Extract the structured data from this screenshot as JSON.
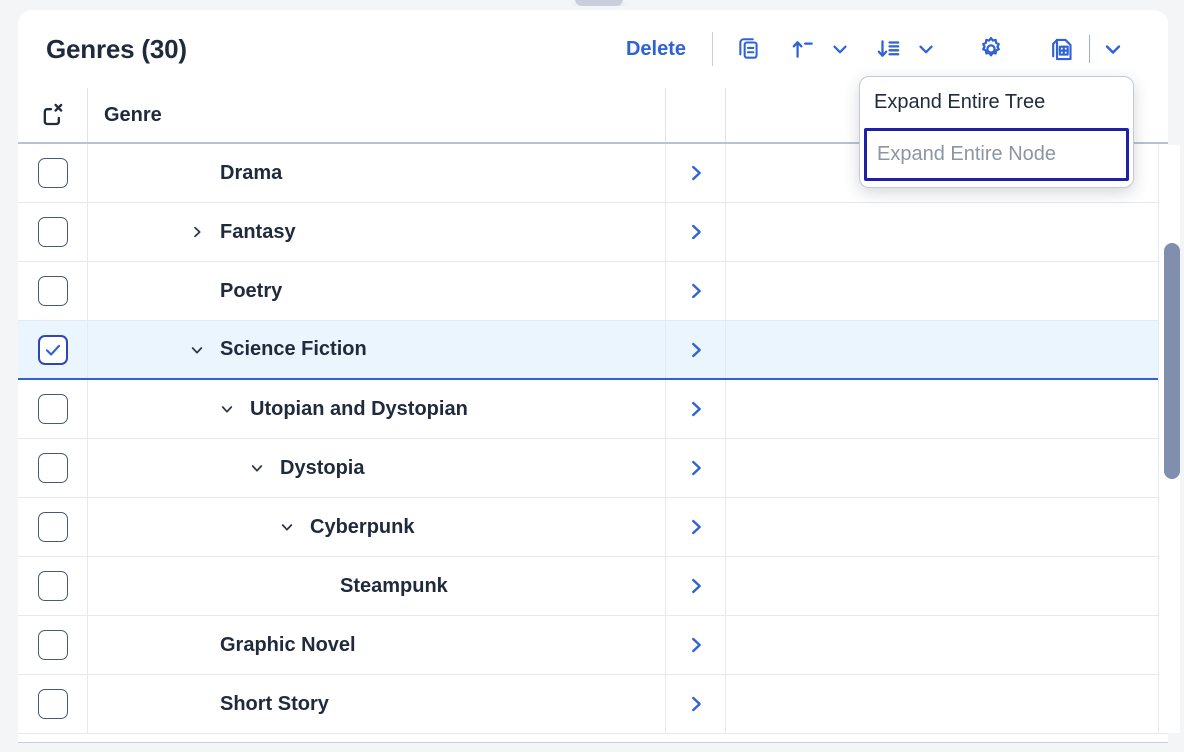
{
  "header": {
    "title": "Genres (30)",
    "delete_label": "Delete",
    "icons": {
      "copy": "copy-rows-icon",
      "insert_above": "insert-above-icon",
      "sort": "sort-descending-icon",
      "settings": "gear-icon",
      "export": "export-table-icon",
      "more": "chevron-down-icon"
    }
  },
  "dropdown": {
    "items": [
      {
        "label": "Expand Entire Tree",
        "disabled": false,
        "focused": false
      },
      {
        "label": "Expand Entire Node",
        "disabled": true,
        "focused": true
      }
    ]
  },
  "table": {
    "select_all_icon": "deselect-all-icon",
    "columns": [
      {
        "label": "Genre"
      }
    ],
    "row_arrow_icon": "chevron-right-icon",
    "rows": [
      {
        "name": "Drama",
        "indent": 0,
        "twisty": "none",
        "checked": false,
        "selected": false
      },
      {
        "name": "Fantasy",
        "indent": 0,
        "twisty": "collapsed",
        "checked": false,
        "selected": false
      },
      {
        "name": "Poetry",
        "indent": 0,
        "twisty": "none",
        "checked": false,
        "selected": false
      },
      {
        "name": "Science Fiction",
        "indent": 0,
        "twisty": "expanded",
        "checked": true,
        "selected": true
      },
      {
        "name": "Utopian and Dystopian",
        "indent": 1,
        "twisty": "expanded",
        "checked": false,
        "selected": false
      },
      {
        "name": "Dystopia",
        "indent": 2,
        "twisty": "expanded",
        "checked": false,
        "selected": false
      },
      {
        "name": "Cyberpunk",
        "indent": 3,
        "twisty": "expanded",
        "checked": false,
        "selected": false
      },
      {
        "name": "Steampunk",
        "indent": 4,
        "twisty": "none",
        "checked": false,
        "selected": false
      },
      {
        "name": "Graphic Novel",
        "indent": 0,
        "twisty": "none",
        "checked": false,
        "selected": false
      },
      {
        "name": "Short Story",
        "indent": 0,
        "twisty": "none",
        "checked": false,
        "selected": false
      }
    ]
  },
  "colors": {
    "accent": "#2f62d6",
    "text": "#1f2a3c",
    "selected_row_bg": "#eaf5fd",
    "focus_ring": "#1f1fa8",
    "scrollbar": "#7f8fad"
  }
}
